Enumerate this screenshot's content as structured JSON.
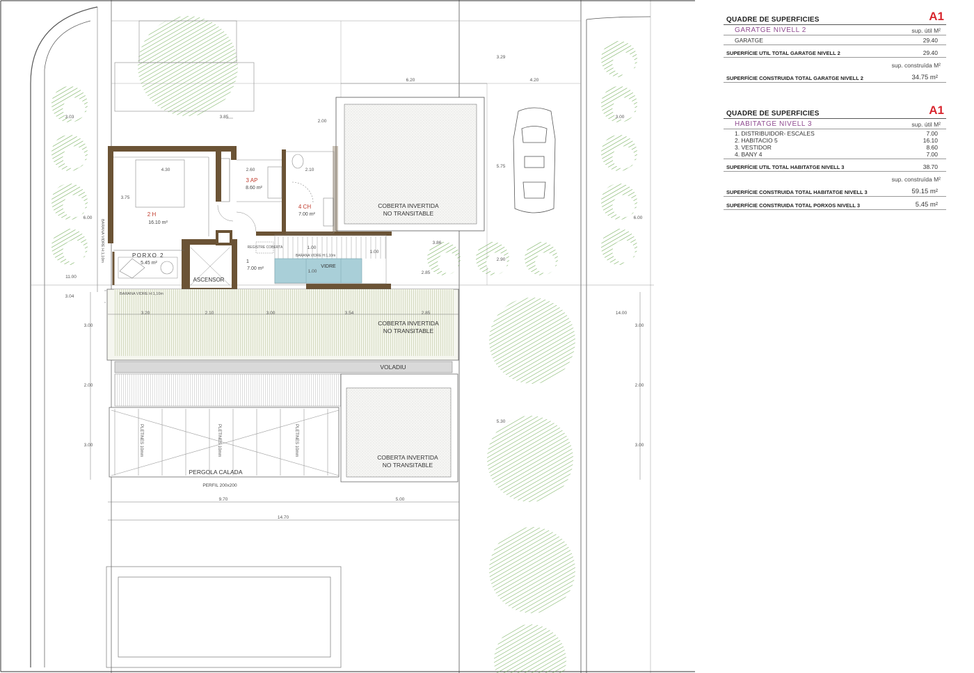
{
  "plan_labels": {
    "room_2h_name": "2 H",
    "room_2h_area": "16.10 m²",
    "room_3ap_name": "3 AP",
    "room_3ap_area": "8.60 m²",
    "room_4ch_name": "4 CH",
    "room_4ch_area": "7.00 m²",
    "room_1_name": "1",
    "room_1_area": "7.00 m²",
    "porxo_name": "PORXO 2",
    "porxo_area": "5.45 m²",
    "ascensor": "ASCENSOR",
    "registre": "REGISTRE COBERTA",
    "vidre": "VIDRE",
    "barana_1": "BARANA VIDRE H:1,10m",
    "barana_2": "BARANA VIDRE H:1,10m",
    "barana_3": "BARANA VIDRE H:1,10m",
    "roof_top_l1": "COBERTA INVERTIDA",
    "roof_top_l2": "NO TRANSITABLE",
    "roof_mid_l1": "COBERTA INVERTIDA",
    "roof_mid_l2": "NO TRANSITABLE",
    "roof_bot_l1": "COBERTA INVERTIDA",
    "roof_bot_l2": "NO TRANSITABLE",
    "voladiu": "VOLADIU",
    "pergola": "PERGOLA CALADA",
    "perfil": "PERFIL 200x200",
    "pletines_1": "PLETINES 10mm",
    "pletines_2": "PLETINES 10mm",
    "pletines_3": "PLETINES 10mm",
    "dims": {
      "d329": "3.29",
      "d620": "6.20",
      "d420": "4.20",
      "d303": "3.03",
      "d385": "3.85",
      "d200a": "2.00",
      "d430": "4.30",
      "d260": "2.60",
      "d210": "2.10",
      "d375": "3.75",
      "d575": "5.75",
      "d600a": "6.00",
      "d600b": "6.00",
      "d100a": "1.00",
      "d100b": "1.00",
      "d100c": "1.00",
      "d386": "3.86",
      "d290": "2.90",
      "d285a": "2.85",
      "d1100": "11.00",
      "d304": "3.04",
      "d320": "3.20",
      "d210b": "2.10",
      "d300a": "3.00",
      "d354": "3.54",
      "d285b": "2.85",
      "d1400": "14.00",
      "d300b": "3.00",
      "d300c": "3.00",
      "d200b": "2.00",
      "d200c": "2.00",
      "d530": "5.30",
      "d300d": "3.00",
      "d300e": "3.00",
      "d970": "9.70",
      "d500": "5.00",
      "d1470": "14.70",
      "d300f": "3.00"
    }
  },
  "table_garage": {
    "title": "QUADRE DE SUPERFICIES",
    "code": "A1",
    "section": "GARATGE NIVELL 2",
    "util_unit": "sup. útil M²",
    "rows": [
      {
        "label": "GARATGE",
        "value": "29.40"
      }
    ],
    "total_util_label": "SUPERFÍCIE UTIL TOTAL GARATGE NIVELL 2",
    "total_util_value": "29.40",
    "built_unit": "sup. construïda M²",
    "total_built_label": "SUPERFÍCIE CONSTRUIDA TOTAL GARATGE NIVELL 2",
    "total_built_value": "34.75 m²"
  },
  "table_house": {
    "title": "QUADRE DE SUPERFICIES",
    "code": "A1",
    "section": "HABITATGE NIVELL 3",
    "util_unit": "sup. útil M²",
    "rows": [
      {
        "label": "1. DISTRIBUIDOR- ESCALES",
        "value": "7.00"
      },
      {
        "label": "2. HABITACIO 5",
        "value": "16.10"
      },
      {
        "label": "3. VESTIDOR",
        "value": "8.60"
      },
      {
        "label": "4. BANY 4",
        "value": "7.00"
      }
    ],
    "total_util_label": "SUPERFÍCIE UTIL TOTAL HABITATGE NIVELL 3",
    "total_util_value": "38.70",
    "built_unit": "sup. construïda M²",
    "total_built_label": "SUPERFÍCIE CONSTRUIDA TOTAL HABITATGE NIVELL 3",
    "total_built_value": "59.15 m²",
    "total_porch_label": "SUPERFÍCIE CONSTRUIDA TOTAL PORXOS NIVELL 3",
    "total_porch_value": "5.45 m²"
  },
  "colors": {
    "wall": "#6b5335",
    "glass": "#a9cfd8",
    "tree_green": "#6aa84f",
    "roof_fill": "#eef1e4",
    "table_accent": "#d8262e",
    "section_purple": "#8e4a8f"
  }
}
